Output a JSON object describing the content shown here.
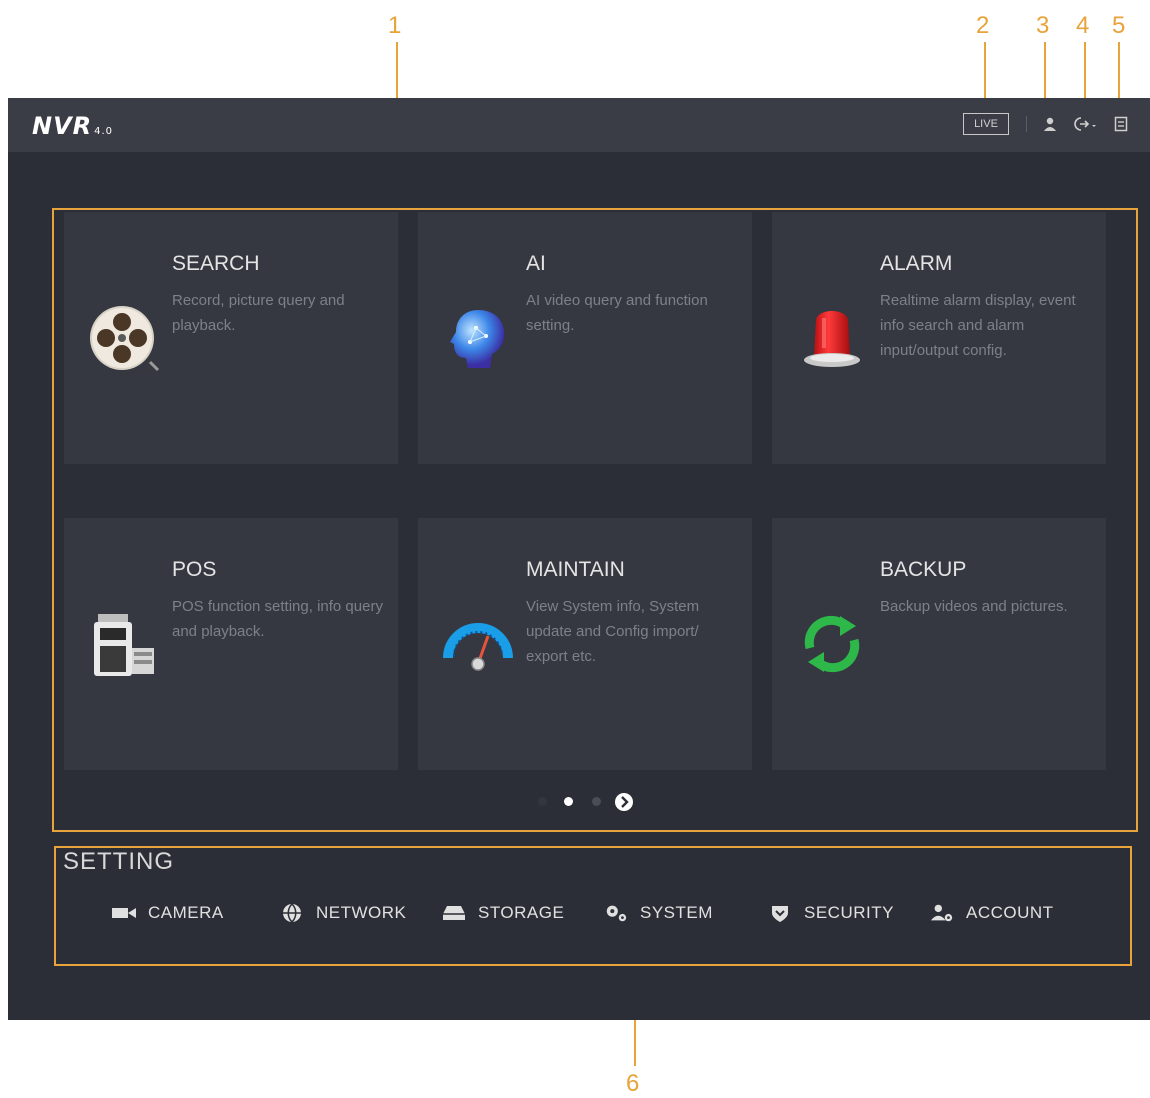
{
  "callouts": [
    "1",
    "2",
    "3",
    "4",
    "5",
    "6"
  ],
  "topbar": {
    "logo": "NVR",
    "logo_version": "4.0",
    "live_label": "LIVE",
    "icons": [
      "user-icon",
      "logout-icon",
      "menu-icon"
    ]
  },
  "cards": [
    {
      "title": "SEARCH",
      "desc": "Record, picture query and playback.",
      "icon": "film-reel-icon"
    },
    {
      "title": "AI",
      "desc": "AI video query and function setting.",
      "icon": "ai-brain-icon"
    },
    {
      "title": "ALARM",
      "desc": "Realtime alarm display, event info search and alarm input/output config.",
      "icon": "alarm-siren-icon"
    },
    {
      "title": "POS",
      "desc": "POS function setting, info query and playback.",
      "icon": "pos-terminal-icon"
    },
    {
      "title": "MAINTAIN",
      "desc": "View System info, System update and Config import/ export etc.",
      "icon": "gauge-icon"
    },
    {
      "title": "BACKUP",
      "desc": "Backup videos and pictures.",
      "icon": "refresh-arrows-icon"
    }
  ],
  "pager": {
    "pages": 3,
    "current": 1
  },
  "settings": {
    "title": "SETTING",
    "items": [
      {
        "label": "CAMERA",
        "icon": "camera-icon"
      },
      {
        "label": "NETWORK",
        "icon": "network-globe-icon"
      },
      {
        "label": "STORAGE",
        "icon": "storage-icon"
      },
      {
        "label": "SYSTEM",
        "icon": "gears-icon"
      },
      {
        "label": "SECURITY",
        "icon": "shield-icon"
      },
      {
        "label": "ACCOUNT",
        "icon": "account-icon"
      }
    ]
  },
  "colors": {
    "callout": "#e8a33a",
    "screen_bg": "#2b2e36",
    "card_bg": "#353840"
  }
}
